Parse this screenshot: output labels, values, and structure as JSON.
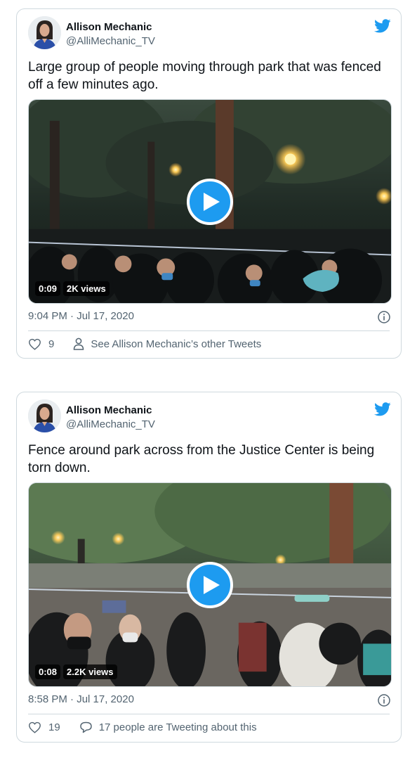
{
  "colors": {
    "accent": "#1d9bf0",
    "secondary_text": "#536471",
    "border": "#cfd9de"
  },
  "icons": {
    "brand": "twitter-bird-icon",
    "play": "play-icon",
    "info": "info-icon",
    "like": "heart-icon",
    "profile": "person-icon",
    "reply": "speech-bubble-icon"
  },
  "tweets": [
    {
      "display_name": "Allison Mechanic",
      "handle": "@AlliMechanic_TV",
      "text": "Large group of people moving through park that was fenced off a few minutes ago.",
      "video": {
        "duration": "0:09",
        "views": "2K views"
      },
      "timestamp": "9:04 PM · Jul 17, 2020",
      "likes": "9",
      "secondary_action": "See Allison Mechanic’s other Tweets"
    },
    {
      "display_name": "Allison Mechanic",
      "handle": "@AlliMechanic_TV",
      "text": "Fence around park across from the Justice Center is being torn down.",
      "video": {
        "duration": "0:08",
        "views": "2.2K views"
      },
      "timestamp": "8:58 PM · Jul 17, 2020",
      "likes": "19",
      "secondary_action": "17 people are Tweeting about this"
    }
  ]
}
